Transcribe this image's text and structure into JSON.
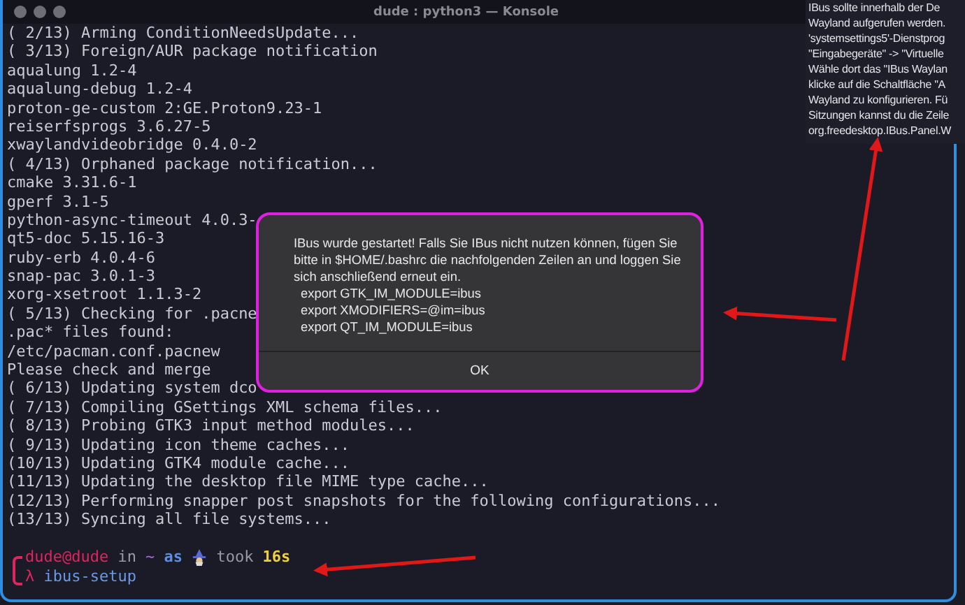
{
  "window": {
    "title": "dude : python3 — Konsole"
  },
  "terminal": {
    "lines": [
      "( 2/13) Arming ConditionNeedsUpdate...",
      "( 3/13) Foreign/AUR package notification",
      "aqualung 1.2-4",
      "aqualung-debug 1.2-4",
      "proton-ge-custom 2:GE.Proton9.23-1",
      "reiserfsprogs 3.6.27-5",
      "xwaylandvideobridge 0.4.0-2",
      "( 4/13) Orphaned package notification...",
      "cmake 3.31.6-1",
      "gperf 3.1-5",
      "python-async-timeout 4.0.3-",
      "qt5-doc 5.15.16-3",
      "ruby-erb 4.0.4-6",
      "snap-pac 3.0.1-3",
      "xorg-xsetroot 1.1.3-2",
      "( 5/13) Checking for .pacne",
      ".pac* files found:",
      "/etc/pacman.conf.pacnew",
      "Please check and merge",
      "( 6/13) Updating system dco",
      "( 7/13) Compiling GSettings XML schema files...",
      "( 8/13) Probing GTK3 input method modules...",
      "( 9/13) Updating icon theme caches...",
      "(10/13) Updating GTK4 module cache...",
      "(11/13) Updating the desktop file MIME type cache...",
      "(12/13) Performing snapper post snapshots for the following configurations...",
      "(13/13) Syncing all file systems..."
    ],
    "prompt": {
      "user_host": "dude@dude",
      "in": "in",
      "dir": "~",
      "as": "as",
      "took": "took",
      "duration": "16s"
    },
    "command_line": {
      "symbol": "λ",
      "command": "ibus-setup"
    }
  },
  "dialog": {
    "message": "IBus wurde gestartet! Falls Sie IBus nicht nutzen können, fügen Sie bitte in $HOME/.bashrc die nachfolgenden Zeilen an und loggen Sie sich anschließend erneut ein.",
    "exports": [
      "export GTK_IM_MODULE=ibus",
      "export XMODIFIERS=@im=ibus",
      "export QT_IM_MODULE=ibus"
    ],
    "button": "OK"
  },
  "notification_panel": {
    "lines": [
      "IBus sollte innerhalb der De",
      "Wayland aufgerufen werden.",
      "'systemsettings5'-Dienstprog",
      "\"Eingabegeräte\" -> \"Virtuelle",
      "Wähle dort das \"IBus Waylan",
      "klicke auf die Schaltfläche \"A",
      "Wayland zu konfigurieren. Fü",
      "Sitzungen kannst du die Zeile",
      "org.freedesktop.IBus.Panel.W"
    ]
  }
}
